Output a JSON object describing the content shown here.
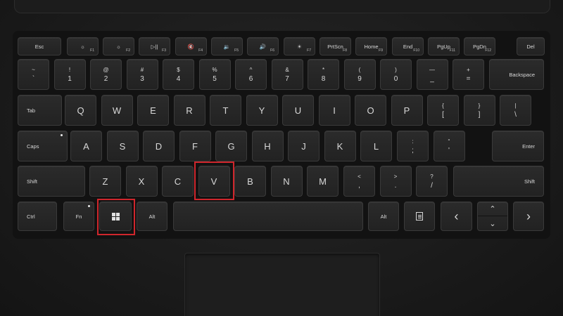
{
  "colors": {
    "highlight": "#d0262c",
    "key": "#252525",
    "text": "#d8d8d8"
  },
  "fn_row": [
    {
      "name": "esc-key",
      "label": "Esc",
      "sub": ""
    },
    {
      "name": "f1-key",
      "label": "☼",
      "sub": "F1"
    },
    {
      "name": "f2-key",
      "label": "☼",
      "sub": "F2"
    },
    {
      "name": "f3-key",
      "label": "▷||",
      "sub": "F3"
    },
    {
      "name": "f4-key",
      "label": "🔇",
      "sub": "F4"
    },
    {
      "name": "f5-key",
      "label": "🔉",
      "sub": "F5"
    },
    {
      "name": "f6-key",
      "label": "🔊",
      "sub": "F6"
    },
    {
      "name": "f7-key",
      "label": "☀",
      "sub": "F7"
    },
    {
      "name": "prtscn-key",
      "label": "PrtScn",
      "sub": "F8"
    },
    {
      "name": "home-key",
      "label": "Home",
      "sub": "F9"
    },
    {
      "name": "end-key",
      "label": "End",
      "sub": "F10"
    },
    {
      "name": "pgup-key",
      "label": "PgUp",
      "sub": "F11"
    },
    {
      "name": "pgdn-key",
      "label": "PgDn",
      "sub": "F12"
    },
    {
      "name": "del-key",
      "label": "Del",
      "sub": ""
    }
  ],
  "number_row": [
    {
      "top": "~",
      "bot": "`"
    },
    {
      "top": "!",
      "bot": "1"
    },
    {
      "top": "@",
      "bot": "2"
    },
    {
      "top": "#",
      "bot": "3"
    },
    {
      "top": "$",
      "bot": "4"
    },
    {
      "top": "%",
      "bot": "5"
    },
    {
      "top": "^",
      "bot": "6"
    },
    {
      "top": "&",
      "bot": "7"
    },
    {
      "top": "*",
      "bot": "8"
    },
    {
      "top": "(",
      "bot": "9"
    },
    {
      "top": ")",
      "bot": "0"
    },
    {
      "top": "—",
      "bot": "_"
    },
    {
      "top": "+",
      "bot": "="
    }
  ],
  "backspace": "Backspace",
  "tab": "Tab",
  "qwerty": [
    "Q",
    "W",
    "E",
    "R",
    "T",
    "Y",
    "U",
    "I",
    "O",
    "P"
  ],
  "qwerty_extra": [
    {
      "top": "{",
      "bot": "["
    },
    {
      "top": "}",
      "bot": "]"
    },
    {
      "top": "|",
      "bot": "\\"
    }
  ],
  "caps": "Caps",
  "asdf": [
    "A",
    "S",
    "D",
    "F",
    "G",
    "H",
    "J",
    "K",
    "L"
  ],
  "asdf_extra": [
    {
      "top": ":",
      "bot": ";"
    },
    {
      "top": "“",
      "bot": "'"
    }
  ],
  "enter": "Enter",
  "shift": "Shift",
  "zxcv": [
    "Z",
    "X",
    "C",
    "V",
    "B",
    "N",
    "M"
  ],
  "zxcv_extra": [
    {
      "top": "<",
      "bot": ","
    },
    {
      "top": ">",
      "bot": "."
    },
    {
      "top": "?",
      "bot": "/"
    }
  ],
  "ctrl": "Ctrl",
  "fn": "Fn",
  "alt": "Alt",
  "arrows": {
    "left": "‹",
    "up": "⌃",
    "down": "⌄",
    "right": "›"
  }
}
